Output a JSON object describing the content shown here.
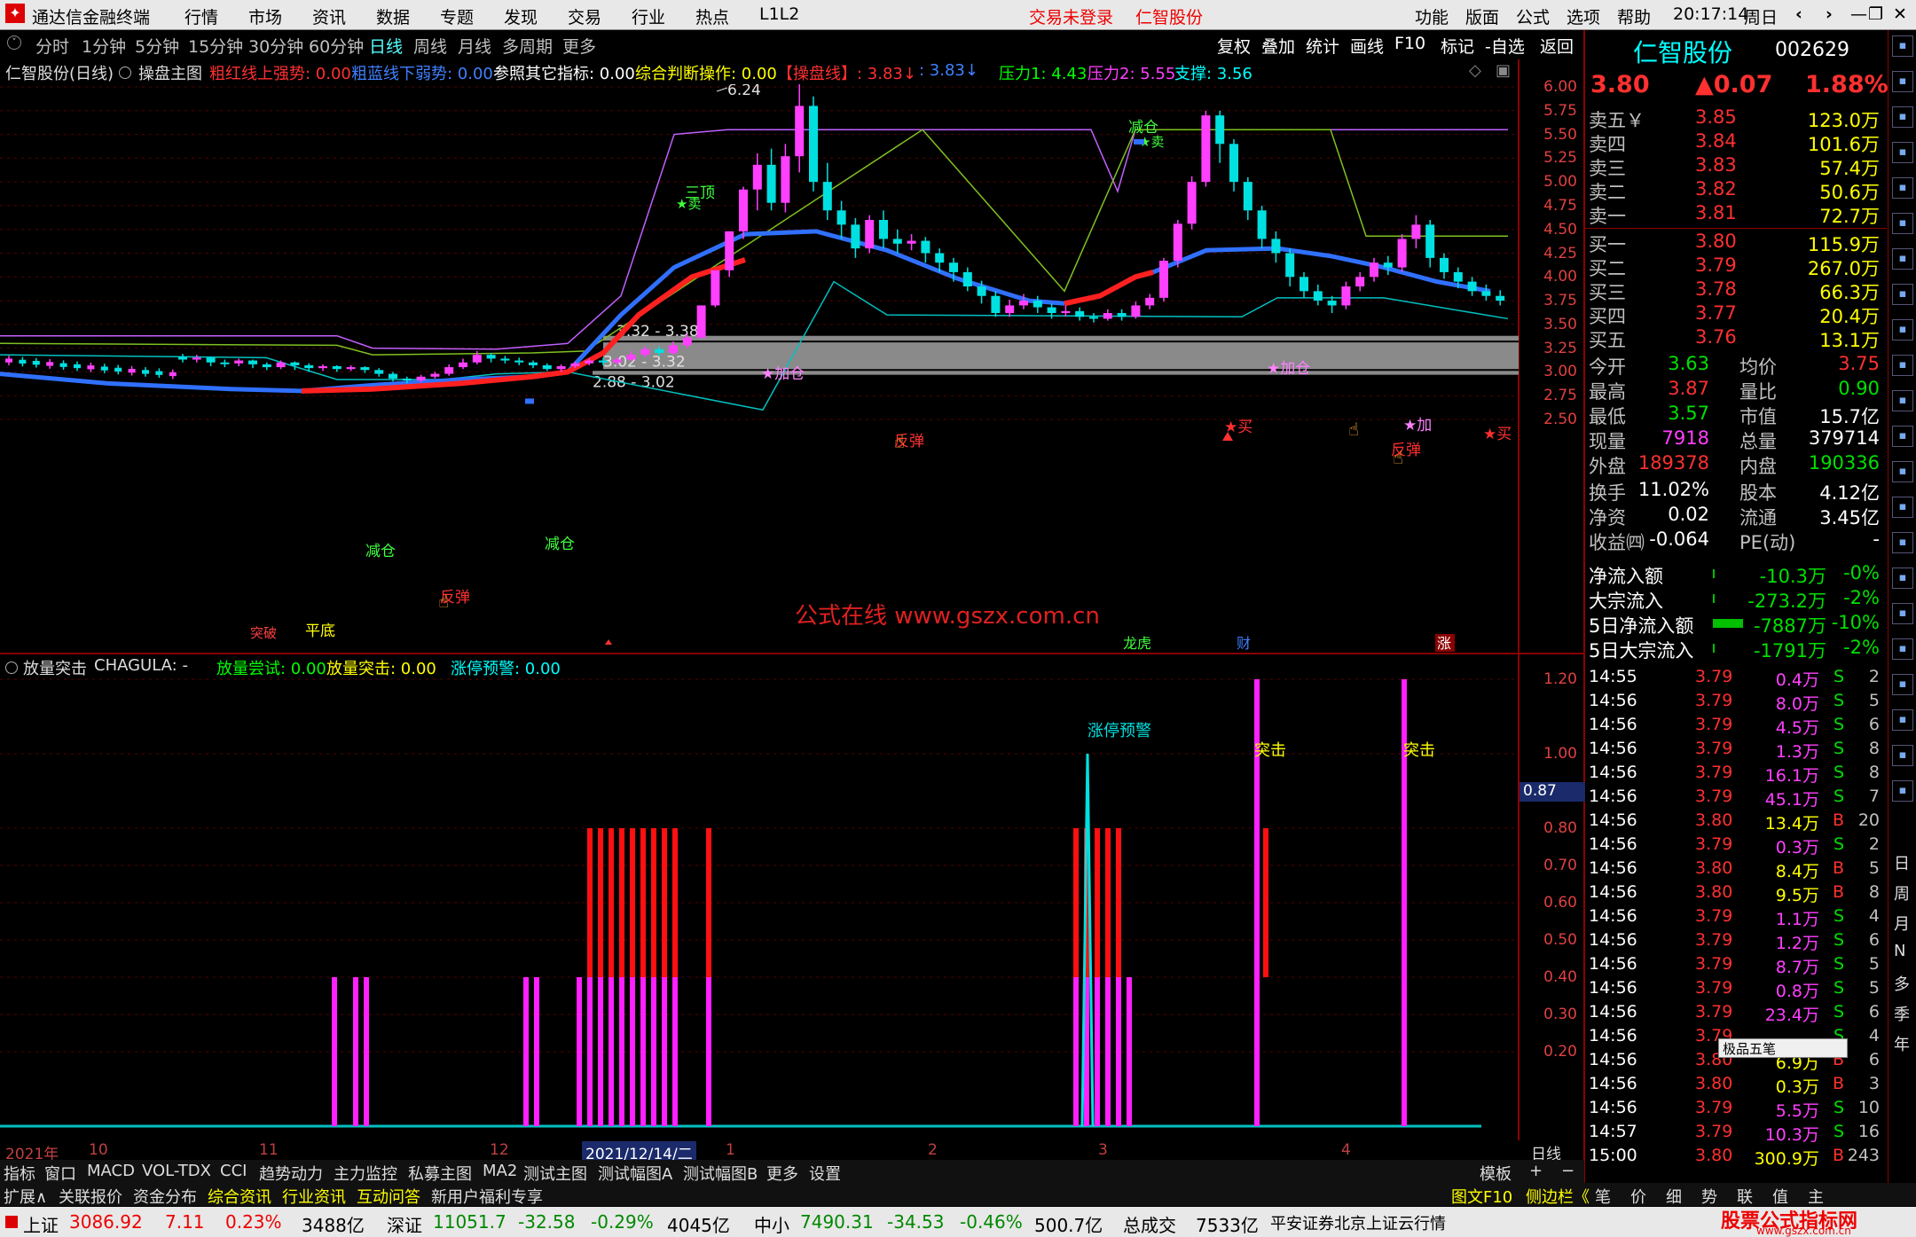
{
  "titlebar": {
    "app_title": "通达信金融终端",
    "menus": [
      "行情",
      "市场",
      "资讯",
      "数据",
      "专题",
      "发现",
      "交易",
      "行业",
      "热点",
      "L1L2"
    ],
    "login_status": "交易未登录",
    "stock_name": "仁智股份",
    "right_menus": [
      "功能",
      "版面",
      "公式",
      "选项",
      "帮助"
    ],
    "time": "20:17:14",
    "weekday": "周日"
  },
  "periodbar": {
    "periods": [
      "分时",
      "1分钟",
      "5分钟",
      "15分钟",
      "30分钟",
      "60分钟",
      "日线",
      "周线",
      "月线",
      "多周期",
      "更多"
    ],
    "selected": "日线",
    "tools": [
      "复权",
      "叠加",
      "统计",
      "画线",
      "F10",
      "标记",
      "-自选",
      "返回"
    ]
  },
  "main_header": {
    "stock": "仁智股份(日线)",
    "indicator": "操盘主图",
    "items": [
      {
        "text": "粗红线上强势: 0.00",
        "color": "#ff3030"
      },
      {
        "text": "粗蓝线下弱势: 0.00",
        "color": "#4080ff"
      },
      {
        "text": "参照其它指标: 0.00",
        "color": "#ffffff"
      },
      {
        "text": "综合判断操作: 0.00",
        "color": "#ffff00"
      },
      {
        "text": "【操盘线】: 3.83↓",
        "color": "#ff3030"
      },
      {
        "text": ": 3.83↓",
        "color": "#4080ff"
      },
      {
        "text": "压力1: 4.43",
        "color": "#00ff00"
      },
      {
        "text": "压力2: 5.55",
        "color": "#ff40ff"
      },
      {
        "text": "支撑: 3.56",
        "color": "#00ffff"
      }
    ]
  },
  "main_axis": {
    "ticks": [
      "6.00",
      "5.75",
      "5.50",
      "5.25",
      "5.00",
      "4.75",
      "4.50",
      "4.25",
      "4.00",
      "3.75",
      "3.50",
      "3.25",
      "3.00",
      "2.75",
      "2.50"
    ]
  },
  "annotations": {
    "high_label": "6.24",
    "zone1": "3.32 - 3.38",
    "zone2": "3.02 - 3.32",
    "zone3": "2.88 - 3.02",
    "watermark": "公式在线  www.gszx.com.cn",
    "signals": {
      "reduce": "减仓",
      "sell": "卖",
      "add": "加仓",
      "add_short": "加",
      "buy": "买",
      "rebound": "反弹",
      "top": "三顶",
      "flatbottom": "平底",
      "breakthrough": "突破"
    },
    "events": [
      "龙虎",
      "财",
      "涨"
    ]
  },
  "sub_header": {
    "name": "放量突击",
    "code": "CHAGULA: -",
    "items": [
      {
        "text": "放量尝试: 0.00",
        "color": "#00ff00"
      },
      {
        "text": "放量突击: 0.00",
        "color": "#ffff00"
      },
      {
        "text": "涨停预警: 0.00",
        "color": "#00ffff"
      }
    ],
    "label_warning": "涨停预警",
    "label_attack": "突击",
    "cursor_value": "0.87"
  },
  "sub_axis": {
    "ticks": [
      "1.20",
      "1.00",
      "0.80",
      "0.70",
      "0.60",
      "0.50",
      "0.40",
      "0.30",
      "0.20"
    ]
  },
  "date_axis": {
    "labels": [
      "2021年",
      "10",
      "11",
      "12",
      "2021/12/14/二",
      "1",
      "2",
      "3",
      "4"
    ],
    "period": "日线"
  },
  "tabs1": [
    "指标",
    "窗口",
    "MACD",
    "VOL-TDX",
    "CCI",
    "趋势动力",
    "主力监控",
    "私募主图",
    "MA2",
    "测试主图",
    "测试幅图A",
    "测试幅图B",
    "更多",
    "设置"
  ],
  "tabs1_right": "模板",
  "tabs2": [
    "扩展∧",
    "关联报价",
    "资金分布",
    "综合资讯",
    "行业资讯",
    "互动问答",
    "新用户福利专享"
  ],
  "tabs2_right": [
    "图文F10",
    "侧边栏《",
    "笔",
    "价",
    "细",
    "势",
    "联",
    "值",
    "主"
  ],
  "right_panel": {
    "name": "仁智股份",
    "code": "002629",
    "price": "3.80",
    "change": "▲0.07",
    "change_pct": "1.88%",
    "asks": [
      {
        "label": "卖五￥",
        "price": "3.85",
        "vol": "123.0万"
      },
      {
        "label": "卖四",
        "price": "3.84",
        "vol": "101.6万"
      },
      {
        "label": "卖三",
        "price": "3.83",
        "vol": "57.4万"
      },
      {
        "label": "卖二",
        "price": "3.82",
        "vol": "50.6万"
      },
      {
        "label": "卖一",
        "price": "3.81",
        "vol": "72.7万"
      }
    ],
    "bids": [
      {
        "label": "买一",
        "price": "3.80",
        "vol": "115.9万"
      },
      {
        "label": "买二",
        "price": "3.79",
        "vol": "267.0万"
      },
      {
        "label": "买三",
        "price": "3.78",
        "vol": "66.3万"
      },
      {
        "label": "买四",
        "price": "3.77",
        "vol": "20.4万"
      },
      {
        "label": "买五",
        "price": "3.76",
        "vol": "13.1万"
      }
    ],
    "stats": [
      {
        "l1": "今开",
        "v1": "3.63",
        "c1": "#00e000",
        "l2": "均价",
        "v2": "3.75",
        "c2": "#ff3030"
      },
      {
        "l1": "最高",
        "v1": "3.87",
        "c1": "#ff3030",
        "l2": "量比",
        "v2": "0.90",
        "c2": "#00e000"
      },
      {
        "l1": "最低",
        "v1": "3.57",
        "c1": "#00e000",
        "l2": "市值",
        "v2": "15.7亿",
        "c2": "#ffffff"
      },
      {
        "l1": "现量",
        "v1": "7918",
        "c1": "#ff40ff",
        "l2": "总量",
        "v2": "379714",
        "c2": "#ffffff"
      },
      {
        "l1": "外盘",
        "v1": "189378",
        "c1": "#ff3030",
        "l2": "内盘",
        "v2": "190336",
        "c2": "#00e000"
      }
    ],
    "stats2": [
      {
        "l1": "换手",
        "v1": "11.02%",
        "l2": "股本",
        "v2": "4.12亿"
      },
      {
        "l1": "净资",
        "v1": "0.02",
        "l2": "流通",
        "v2": "3.45亿"
      },
      {
        "l1": "收益㈣",
        "v1": "-0.064",
        "l2": "PE(动)",
        "v2": "-"
      }
    ],
    "flows": [
      {
        "label": "净流入额",
        "value": "-10.3万",
        "pct": "-0%"
      },
      {
        "label": "大宗流入",
        "value": "-273.2万",
        "pct": "-2%"
      },
      {
        "label": "5日净流入额",
        "value": "-7887万",
        "pct": "-10%"
      },
      {
        "label": "5日大宗流入",
        "value": "-1791万",
        "pct": "-2%"
      }
    ],
    "ticks": [
      {
        "t": "14:55",
        "p": "3.79",
        "v": "0.4万",
        "s": "S",
        "n": "2"
      },
      {
        "t": "14:56",
        "p": "3.79",
        "v": "8.0万",
        "s": "S",
        "n": "5"
      },
      {
        "t": "14:56",
        "p": "3.79",
        "v": "4.5万",
        "s": "S",
        "n": "6"
      },
      {
        "t": "14:56",
        "p": "3.79",
        "v": "1.3万",
        "s": "S",
        "n": "8"
      },
      {
        "t": "14:56",
        "p": "3.79",
        "v": "16.1万",
        "s": "S",
        "n": "8"
      },
      {
        "t": "14:56",
        "p": "3.79",
        "v": "45.1万",
        "s": "S",
        "n": "7"
      },
      {
        "t": "14:56",
        "p": "3.80",
        "v": "13.4万",
        "s": "B",
        "n": "20"
      },
      {
        "t": "14:56",
        "p": "3.79",
        "v": "0.3万",
        "s": "S",
        "n": "2"
      },
      {
        "t": "14:56",
        "p": "3.80",
        "v": "8.4万",
        "s": "B",
        "n": "5"
      },
      {
        "t": "14:56",
        "p": "3.80",
        "v": "9.5万",
        "s": "B",
        "n": "8"
      },
      {
        "t": "14:56",
        "p": "3.79",
        "v": "1.1万",
        "s": "S",
        "n": "4"
      },
      {
        "t": "14:56",
        "p": "3.79",
        "v": "1.2万",
        "s": "S",
        "n": "6"
      },
      {
        "t": "14:56",
        "p": "3.79",
        "v": "8.7万",
        "s": "S",
        "n": "5"
      },
      {
        "t": "14:56",
        "p": "3.79",
        "v": "0.8万",
        "s": "S",
        "n": "5"
      },
      {
        "t": "14:56",
        "p": "3.79",
        "v": "23.4万",
        "s": "S",
        "n": "6"
      },
      {
        "t": "14:56",
        "p": "3.79",
        "v": "",
        "s": "S",
        "n": "4"
      },
      {
        "t": "14:56",
        "p": "3.80",
        "v": "6.9万",
        "s": "B",
        "n": "6"
      },
      {
        "t": "14:56",
        "p": "3.80",
        "v": "0.3万",
        "s": "B",
        "n": "3"
      },
      {
        "t": "14:56",
        "p": "3.79",
        "v": "5.5万",
        "s": "S",
        "n": "10"
      },
      {
        "t": "14:57",
        "p": "3.79",
        "v": "10.3万",
        "s": "S",
        "n": "16"
      },
      {
        "t": "15:00",
        "p": "3.80",
        "v": "300.9万",
        "s": "B",
        "n": "243"
      }
    ],
    "popup": "极品五笔"
  },
  "right_icons": [
    "日",
    "周",
    "月",
    "N",
    "多",
    "季",
    "年"
  ],
  "statusbar": [
    {
      "label": "上证",
      "value": "3086.92",
      "chg": "7.11",
      "pct": "0.23%",
      "amt": "3488亿",
      "up": true
    },
    {
      "label": "深证",
      "value": "11051.7",
      "chg": "-32.58",
      "pct": "-0.29%",
      "amt": "4045亿",
      "up": false
    },
    {
      "label": "中小",
      "value": "7490.31",
      "chg": "-34.53",
      "pct": "-0.46%",
      "amt": "500.7亿",
      "up": false
    }
  ],
  "status_total_label": "总成交",
  "status_total": "7533亿",
  "status_server": "平安证券北京上证云行情",
  "status_logo": "股票公式指标网",
  "status_logo_url": "www.gszx.com.cn",
  "candles": [
    [
      3.16,
      3.13,
      3.19,
      3.1
    ],
    [
      3.13,
      3.15,
      3.18,
      3.1
    ],
    [
      3.15,
      3.1,
      3.16,
      3.06
    ],
    [
      3.1,
      3.09,
      3.13,
      3.05
    ],
    [
      3.09,
      3.12,
      3.14,
      3.06
    ],
    [
      3.12,
      3.08,
      3.13,
      3.04
    ],
    [
      3.08,
      3.05,
      3.1,
      3.02
    ],
    [
      3.05,
      3.1,
      3.12,
      3.03
    ],
    [
      3.1,
      3.07,
      3.11,
      3.02
    ],
    [
      3.07,
      3.04,
      3.09,
      3.0
    ],
    [
      3.04,
      3.06,
      3.08,
      3.01
    ],
    [
      3.06,
      3.03,
      3.07,
      3.0
    ],
    [
      3.03,
      3.05,
      3.07,
      3.01
    ],
    [
      3.05,
      3.02,
      3.06,
      2.99
    ],
    [
      3.02,
      2.98,
      3.04,
      2.95
    ],
    [
      2.98,
      2.93,
      3.0,
      2.9
    ],
    [
      2.93,
      2.91,
      2.95,
      2.88
    ],
    [
      2.91,
      2.95,
      2.97,
      2.89
    ],
    [
      2.95,
      2.98,
      3.0,
      2.93
    ],
    [
      2.98,
      3.05,
      3.08,
      2.96
    ],
    [
      3.05,
      3.1,
      3.14,
      3.03
    ],
    [
      3.1,
      3.18,
      3.22,
      3.08
    ],
    [
      3.18,
      3.14,
      3.2,
      3.1
    ],
    [
      3.14,
      3.12,
      3.17,
      3.09
    ],
    [
      3.12,
      3.1,
      3.15,
      3.07
    ],
    [
      3.1,
      3.07,
      3.12,
      3.04
    ],
    [
      3.07,
      3.03,
      3.09,
      3.01
    ],
    [
      3.03,
      3.06,
      3.08,
      3.0
    ],
    [
      3.06,
      3.09,
      3.11,
      3.04
    ],
    [
      3.09,
      3.12,
      3.14,
      3.07
    ],
    [
      3.12,
      3.1,
      3.15,
      3.07
    ],
    [
      3.1,
      3.13,
      3.16,
      3.08
    ],
    [
      3.13,
      3.18,
      3.22,
      3.11
    ],
    [
      3.18,
      3.24,
      3.27,
      3.15
    ],
    [
      3.24,
      3.2,
      3.27,
      3.17
    ],
    [
      3.2,
      3.28,
      3.32,
      3.18
    ],
    [
      3.28,
      3.36,
      3.4,
      3.25
    ],
    [
      3.36,
      3.7,
      3.7,
      3.35
    ],
    [
      3.7,
      4.07,
      4.07,
      3.68
    ],
    [
      4.07,
      4.48,
      4.48,
      4.0
    ],
    [
      4.48,
      4.92,
      4.95,
      4.4
    ],
    [
      4.92,
      5.18,
      5.3,
      4.7
    ],
    [
      5.18,
      4.78,
      5.35,
      4.7
    ],
    [
      4.78,
      5.27,
      5.4,
      4.68
    ],
    [
      5.27,
      5.8,
      6.24,
      5.1
    ],
    [
      5.8,
      5.0,
      5.9,
      4.9
    ],
    [
      5.0,
      4.7,
      5.2,
      4.6
    ],
    [
      4.7,
      4.55,
      4.8,
      4.4
    ],
    [
      4.55,
      4.3,
      4.62,
      4.2
    ],
    [
      4.3,
      4.6,
      4.65,
      4.25
    ],
    [
      4.6,
      4.4,
      4.7,
      4.3
    ],
    [
      4.4,
      4.35,
      4.5,
      4.25
    ],
    [
      4.35,
      4.38,
      4.45,
      4.28
    ],
    [
      4.38,
      4.25,
      4.42,
      4.15
    ],
    [
      4.25,
      4.15,
      4.3,
      4.05
    ],
    [
      4.15,
      4.05,
      4.2,
      3.95
    ],
    [
      4.05,
      3.9,
      4.1,
      3.85
    ],
    [
      3.9,
      3.8,
      3.96,
      3.72
    ],
    [
      3.8,
      3.62,
      3.85,
      3.58
    ],
    [
      3.62,
      3.7,
      3.76,
      3.58
    ],
    [
      3.7,
      3.75,
      3.82,
      3.66
    ],
    [
      3.75,
      3.68,
      3.8,
      3.62
    ],
    [
      3.68,
      3.62,
      3.72,
      3.56
    ],
    [
      3.62,
      3.64,
      3.7,
      3.58
    ],
    [
      3.64,
      3.58,
      3.68,
      3.54
    ],
    [
      3.58,
      3.56,
      3.62,
      3.52
    ],
    [
      3.56,
      3.62,
      3.66,
      3.54
    ],
    [
      3.62,
      3.58,
      3.66,
      3.54
    ],
    [
      3.58,
      3.7,
      3.74,
      3.56
    ],
    [
      3.7,
      3.78,
      3.82,
      3.66
    ],
    [
      3.78,
      4.17,
      4.2,
      3.74
    ],
    [
      4.17,
      4.56,
      4.6,
      4.1
    ],
    [
      4.56,
      5.0,
      5.06,
      4.5
    ],
    [
      5.0,
      5.7,
      5.75,
      4.95
    ],
    [
      5.7,
      5.4,
      5.75,
      5.2
    ],
    [
      5.4,
      5.0,
      5.45,
      4.9
    ],
    [
      5.0,
      4.7,
      5.05,
      4.6
    ],
    [
      4.7,
      4.4,
      4.75,
      4.3
    ],
    [
      4.4,
      4.25,
      4.48,
      4.15
    ],
    [
      4.25,
      4.0,
      4.3,
      3.9
    ],
    [
      4.0,
      3.85,
      4.05,
      3.78
    ],
    [
      3.85,
      3.75,
      3.92,
      3.7
    ],
    [
      3.75,
      3.7,
      3.8,
      3.62
    ],
    [
      3.7,
      3.9,
      3.95,
      3.66
    ],
    [
      3.9,
      4.0,
      4.05,
      3.85
    ],
    [
      4.0,
      4.15,
      4.2,
      3.95
    ],
    [
      4.15,
      4.1,
      4.22,
      4.02
    ],
    [
      4.1,
      4.4,
      4.45,
      4.05
    ],
    [
      4.4,
      4.55,
      4.65,
      4.3
    ],
    [
      4.55,
      4.2,
      4.6,
      4.1
    ],
    [
      4.2,
      4.05,
      4.25,
      3.98
    ],
    [
      4.05,
      3.95,
      4.1,
      3.88
    ],
    [
      3.95,
      3.85,
      4.0,
      3.8
    ],
    [
      3.85,
      3.8,
      3.92,
      3.75
    ],
    [
      3.8,
      3.75,
      3.86,
      3.7
    ],
    [
      3.75,
      3.85,
      3.9,
      3.7
    ],
    [
      3.85,
      3.72,
      3.9,
      3.66
    ],
    [
      3.72,
      3.66,
      3.78,
      3.6
    ],
    [
      3.66,
      3.8,
      3.86,
      3.62
    ],
    [
      3.8,
      4.1,
      4.28,
      3.76
    ],
    [
      4.1,
      3.95,
      4.15,
      3.88
    ],
    [
      3.95,
      3.86,
      4.0,
      3.8
    ],
    [
      3.86,
      4.0,
      4.05,
      3.82
    ],
    [
      4.0,
      3.9,
      4.08,
      3.84
    ],
    [
      3.9,
      3.8,
      3.95,
      3.72
    ]
  ],
  "ma_red": [],
  "vol_bars": [
    {
      "i": 38,
      "h": 0.4
    },
    {
      "i": 40,
      "h": 0.4
    },
    {
      "i": 41,
      "h": 0.4
    },
    {
      "i": 59,
      "h": 0.4
    },
    {
      "i": 60,
      "h": 0.4
    },
    {
      "i": 66,
      "h": 0.4
    },
    {
      "i": 67,
      "h": 0.8
    },
    {
      "i": 68,
      "h": 0.8
    },
    {
      "i": 69,
      "h": 0.8
    },
    {
      "i": 70,
      "h": 0.8
    },
    {
      "i": 71,
      "h": 0.8
    },
    {
      "i": 72,
      "h": 0.8
    },
    {
      "i": 73,
      "h": 0.8
    },
    {
      "i": 74,
      "h": 0.8
    },
    {
      "i": 75,
      "h": 0.8
    },
    {
      "i": 76,
      "h": 0.8
    },
    {
      "i": 80,
      "h": 0.8
    }
  ]
}
